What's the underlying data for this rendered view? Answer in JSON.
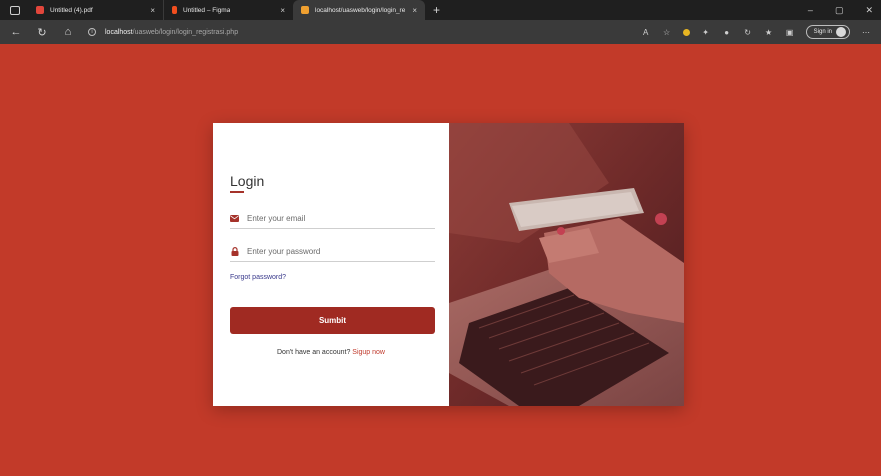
{
  "browser": {
    "tabs": [
      {
        "title": "Untitled (4).pdf",
        "close": "×",
        "favicon_color": "#e2463b"
      },
      {
        "title": "Untitled – Figma",
        "close": "×",
        "favicon_color": "#f24e1e"
      },
      {
        "title": "localhost/uasweb/login/login_re",
        "close": "×",
        "favicon_color": "#f0a030"
      }
    ],
    "new_tab": "+",
    "window_controls": [
      "–",
      "▢",
      "✕"
    ],
    "url_host": "localhost",
    "url_path": "/uasweb/login/login_registrasi.php",
    "sign_in": "Sign in"
  },
  "login": {
    "title": "Login",
    "email_placeholder": "Enter your email",
    "password_placeholder": "Enter your password",
    "forgot": "Forgot password?",
    "submit": "Sumbit",
    "no_account": "Don't have an account?",
    "signup": "Sigup now"
  },
  "colors": {
    "page_bg": "#c23a29",
    "accent": "#a02a22",
    "link": "#3a3a8c"
  }
}
